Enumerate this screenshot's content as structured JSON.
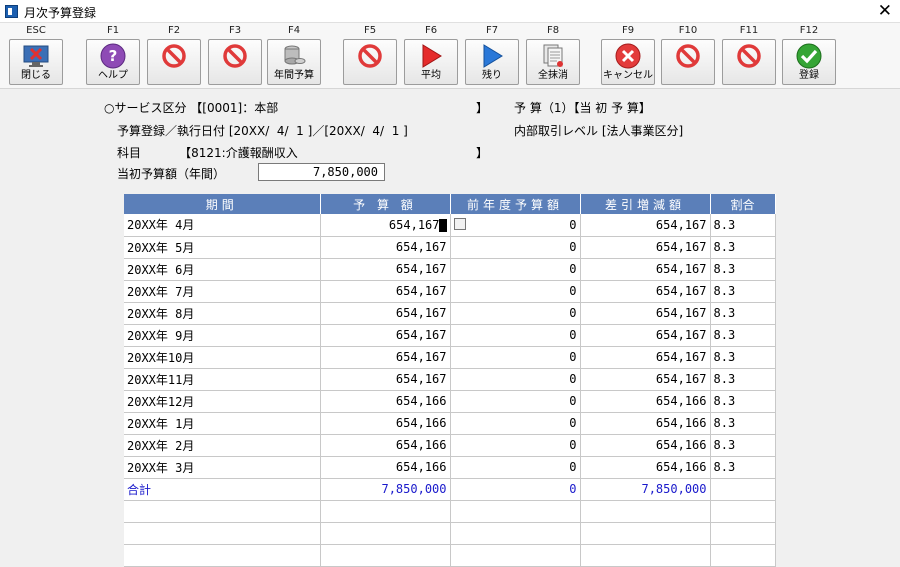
{
  "window": {
    "title": "月次予算登録"
  },
  "toolbar": [
    {
      "key": "ESC",
      "label": "閉じる",
      "icon": "close-window-icon"
    },
    {
      "key": "F1",
      "label": "ヘルプ",
      "icon": "help-icon"
    },
    {
      "key": "F2",
      "label": "",
      "icon": "disabled-icon"
    },
    {
      "key": "F3",
      "label": "",
      "icon": "disabled-icon"
    },
    {
      "key": "F4",
      "label": "年間予算",
      "icon": "coins-icon"
    },
    {
      "key": "F5",
      "label": "",
      "icon": "disabled-icon"
    },
    {
      "key": "F6",
      "label": "平均",
      "icon": "red-play-icon"
    },
    {
      "key": "F7",
      "label": "残り",
      "icon": "blue-play-icon"
    },
    {
      "key": "F8",
      "label": "全抹消",
      "icon": "erase-all-icon"
    },
    {
      "key": "F9",
      "label": "キャンセル",
      "icon": "cancel-icon"
    },
    {
      "key": "F10",
      "label": "",
      "icon": "disabled-icon"
    },
    {
      "key": "F11",
      "label": "",
      "icon": "disabled-icon"
    },
    {
      "key": "F12",
      "label": "登録",
      "icon": "register-check-icon"
    }
  ],
  "info": {
    "service_line": "○サービス区分 【[0001]：本部",
    "service_close": "】",
    "budget_type": "予 算（1）【当 初 予 算】",
    "exec_date": "予算登録／執行日付 [20XX/  4/  1 ]／[20XX/  4/  1 ]",
    "internal_level": "内部取引レベル [法人事業区分]",
    "account_line": "科目          【8121:介護報酬収入",
    "account_close": "】",
    "initial_budget_label": "当初予算額（年間）",
    "initial_budget_value": "7,850,000"
  },
  "table": {
    "headers": [
      "期間",
      "予 算 額",
      "前年度予算額",
      "差引増減額",
      "割合"
    ],
    "rows": [
      [
        "20XX年 4月",
        "654,167",
        "0",
        "654,167",
        "8.3"
      ],
      [
        "20XX年 5月",
        "654,167",
        "0",
        "654,167",
        "8.3"
      ],
      [
        "20XX年 6月",
        "654,167",
        "0",
        "654,167",
        "8.3"
      ],
      [
        "20XX年 7月",
        "654,167",
        "0",
        "654,167",
        "8.3"
      ],
      [
        "20XX年 8月",
        "654,167",
        "0",
        "654,167",
        "8.3"
      ],
      [
        "20XX年 9月",
        "654,167",
        "0",
        "654,167",
        "8.3"
      ],
      [
        "20XX年10月",
        "654,167",
        "0",
        "654,167",
        "8.3"
      ],
      [
        "20XX年11月",
        "654,167",
        "0",
        "654,167",
        "8.3"
      ],
      [
        "20XX年12月",
        "654,166",
        "0",
        "654,166",
        "8.3"
      ],
      [
        "20XX年 1月",
        "654,166",
        "0",
        "654,166",
        "8.3"
      ],
      [
        "20XX年 2月",
        "654,166",
        "0",
        "654,166",
        "8.3"
      ],
      [
        "20XX年 3月",
        "654,166",
        "0",
        "654,166",
        "8.3"
      ]
    ],
    "total": [
      "合計",
      "7,850,000",
      "0",
      "7,850,000",
      ""
    ]
  },
  "colors": {
    "header_bg": "#5b7fb9",
    "total_text": "#1a1acc"
  }
}
